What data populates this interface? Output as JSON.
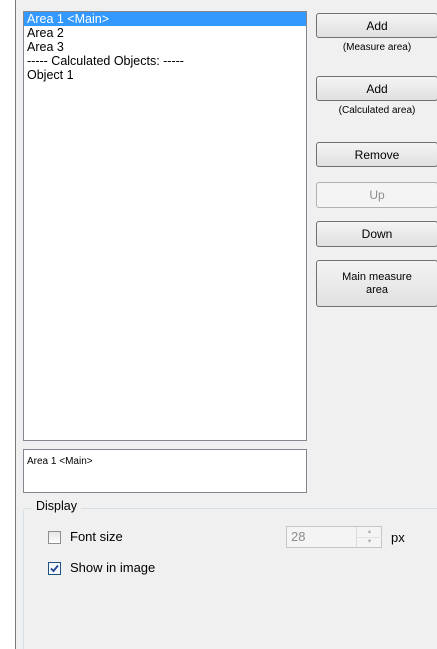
{
  "list": {
    "items": [
      {
        "label": "Area 1 <Main>",
        "selected": true
      },
      {
        "label": "Area 2",
        "selected": false
      },
      {
        "label": "Area 3",
        "selected": false
      },
      {
        "label": "----- Calculated Objects: -----",
        "selected": false
      },
      {
        "label": "Object 1",
        "selected": false
      }
    ]
  },
  "buttons": {
    "add_measure": "Add",
    "add_measure_caption": "(Measure area)",
    "add_calculated": "Add",
    "add_calculated_caption": "(Calculated area)",
    "remove": "Remove",
    "up": "Up",
    "down": "Down",
    "main_measure_area_line1": "Main measure",
    "main_measure_area_line2": "area"
  },
  "status": {
    "text": "Area 1 <Main>"
  },
  "display": {
    "title": "Display",
    "font_size_label": "Font size",
    "font_size_checked": false,
    "font_size_value": "28",
    "font_size_unit": "px",
    "show_in_image_label": "Show in image",
    "show_in_image_checked": true
  },
  "colors": {
    "selection": "#3399ff",
    "panel_background": "#f0f0f0"
  }
}
